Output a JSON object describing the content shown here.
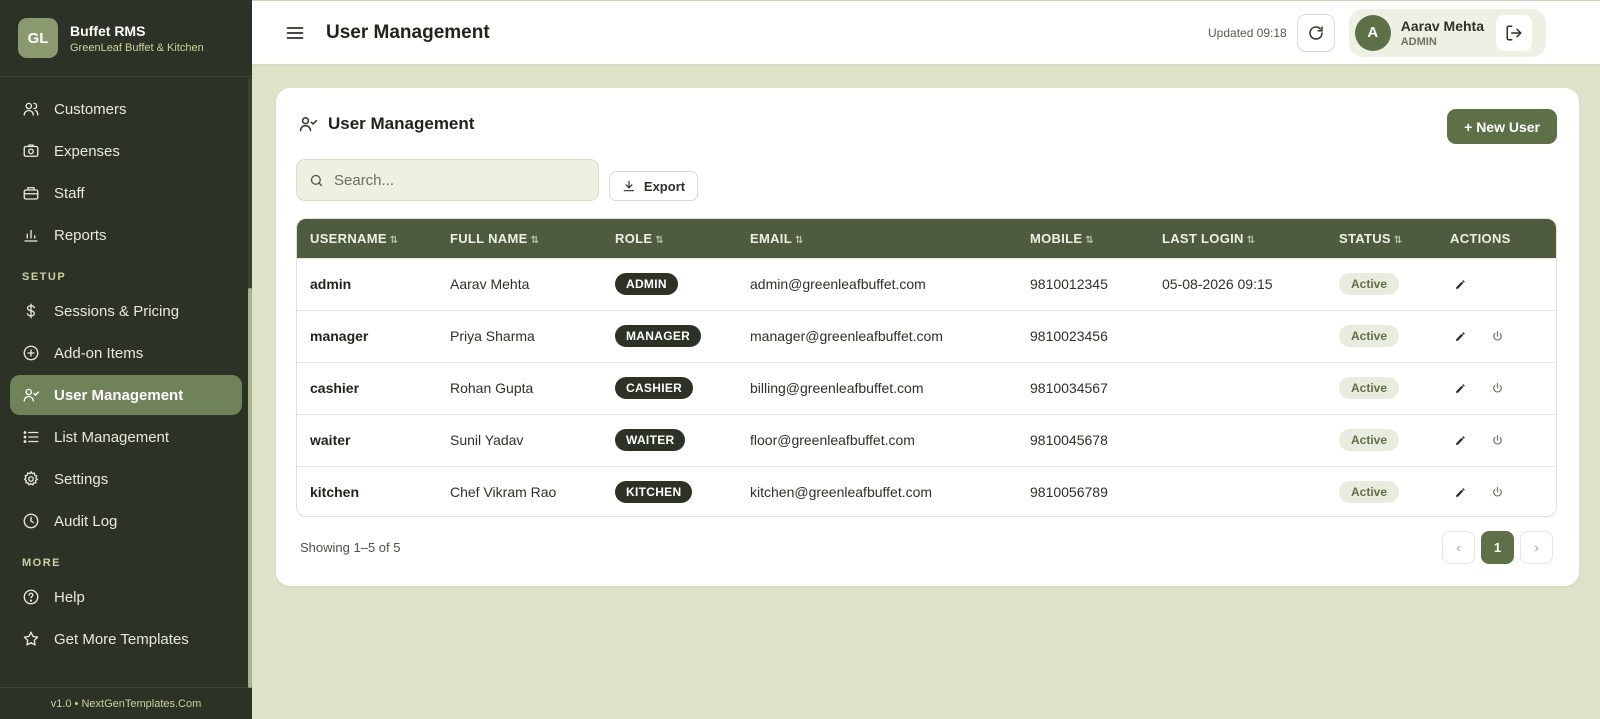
{
  "brand": {
    "logo": "GL",
    "name": "Buffet RMS",
    "subtitle": "GreenLeaf Buffet & Kitchen"
  },
  "sidebar": {
    "items_top": [
      {
        "label": "Customers",
        "icon": "users-icon"
      },
      {
        "label": "Expenses",
        "icon": "camera-icon"
      },
      {
        "label": "Staff",
        "icon": "briefcase-icon"
      },
      {
        "label": "Reports",
        "icon": "bar-chart-icon"
      }
    ],
    "section_setup": "SETUP",
    "items_setup": [
      {
        "label": "Sessions & Pricing",
        "icon": "dollar-icon"
      },
      {
        "label": "Add-on Items",
        "icon": "plus-circle-icon"
      },
      {
        "label": "User Management",
        "icon": "user-check-icon",
        "active": true
      },
      {
        "label": "List Management",
        "icon": "list-icon"
      },
      {
        "label": "Settings",
        "icon": "gear-icon"
      },
      {
        "label": "Audit Log",
        "icon": "clock-icon"
      }
    ],
    "section_more": "MORE",
    "items_more": [
      {
        "label": "Help",
        "icon": "help-circle-icon"
      },
      {
        "label": "Get More Templates",
        "icon": "star-icon"
      }
    ],
    "footer": "v1.0 • NextGenTemplates.Com"
  },
  "topbar": {
    "title": "User Management",
    "updated": "Updated 09:18",
    "user_avatar": "A",
    "user_name": "Aarav Mehta",
    "user_role": "ADMIN"
  },
  "card": {
    "title": "User Management",
    "new_user_label": "+ New User",
    "search_placeholder": "Search...",
    "export_label": "Export"
  },
  "table": {
    "headers": [
      "USERNAME",
      "FULL NAME",
      "ROLE",
      "EMAIL",
      "MOBILE",
      "LAST LOGIN",
      "STATUS",
      "ACTIONS"
    ],
    "rows": [
      {
        "username": "admin",
        "full_name": "Aarav Mehta",
        "role": "ADMIN",
        "email": "admin@greenleafbuffet.com",
        "mobile": "9810012345",
        "last_login": "05-08-2026 09:15",
        "status": "Active",
        "can_toggle": false
      },
      {
        "username": "manager",
        "full_name": "Priya Sharma",
        "role": "MANAGER",
        "email": "manager@greenleafbuffet.com",
        "mobile": "9810023456",
        "last_login": "",
        "status": "Active",
        "can_toggle": true
      },
      {
        "username": "cashier",
        "full_name": "Rohan Gupta",
        "role": "CASHIER",
        "email": "billing@greenleafbuffet.com",
        "mobile": "9810034567",
        "last_login": "",
        "status": "Active",
        "can_toggle": true
      },
      {
        "username": "waiter",
        "full_name": "Sunil Yadav",
        "role": "WAITER",
        "email": "floor@greenleafbuffet.com",
        "mobile": "9810045678",
        "last_login": "",
        "status": "Active",
        "can_toggle": true
      },
      {
        "username": "kitchen",
        "full_name": "Chef Vikram Rao",
        "role": "KITCHEN",
        "email": "kitchen@greenleafbuffet.com",
        "mobile": "9810056789",
        "last_login": "",
        "status": "Active",
        "can_toggle": true
      }
    ]
  },
  "footer": {
    "showing": "Showing 1–5 of 5",
    "prev": "‹",
    "page": "1",
    "next": "›"
  }
}
